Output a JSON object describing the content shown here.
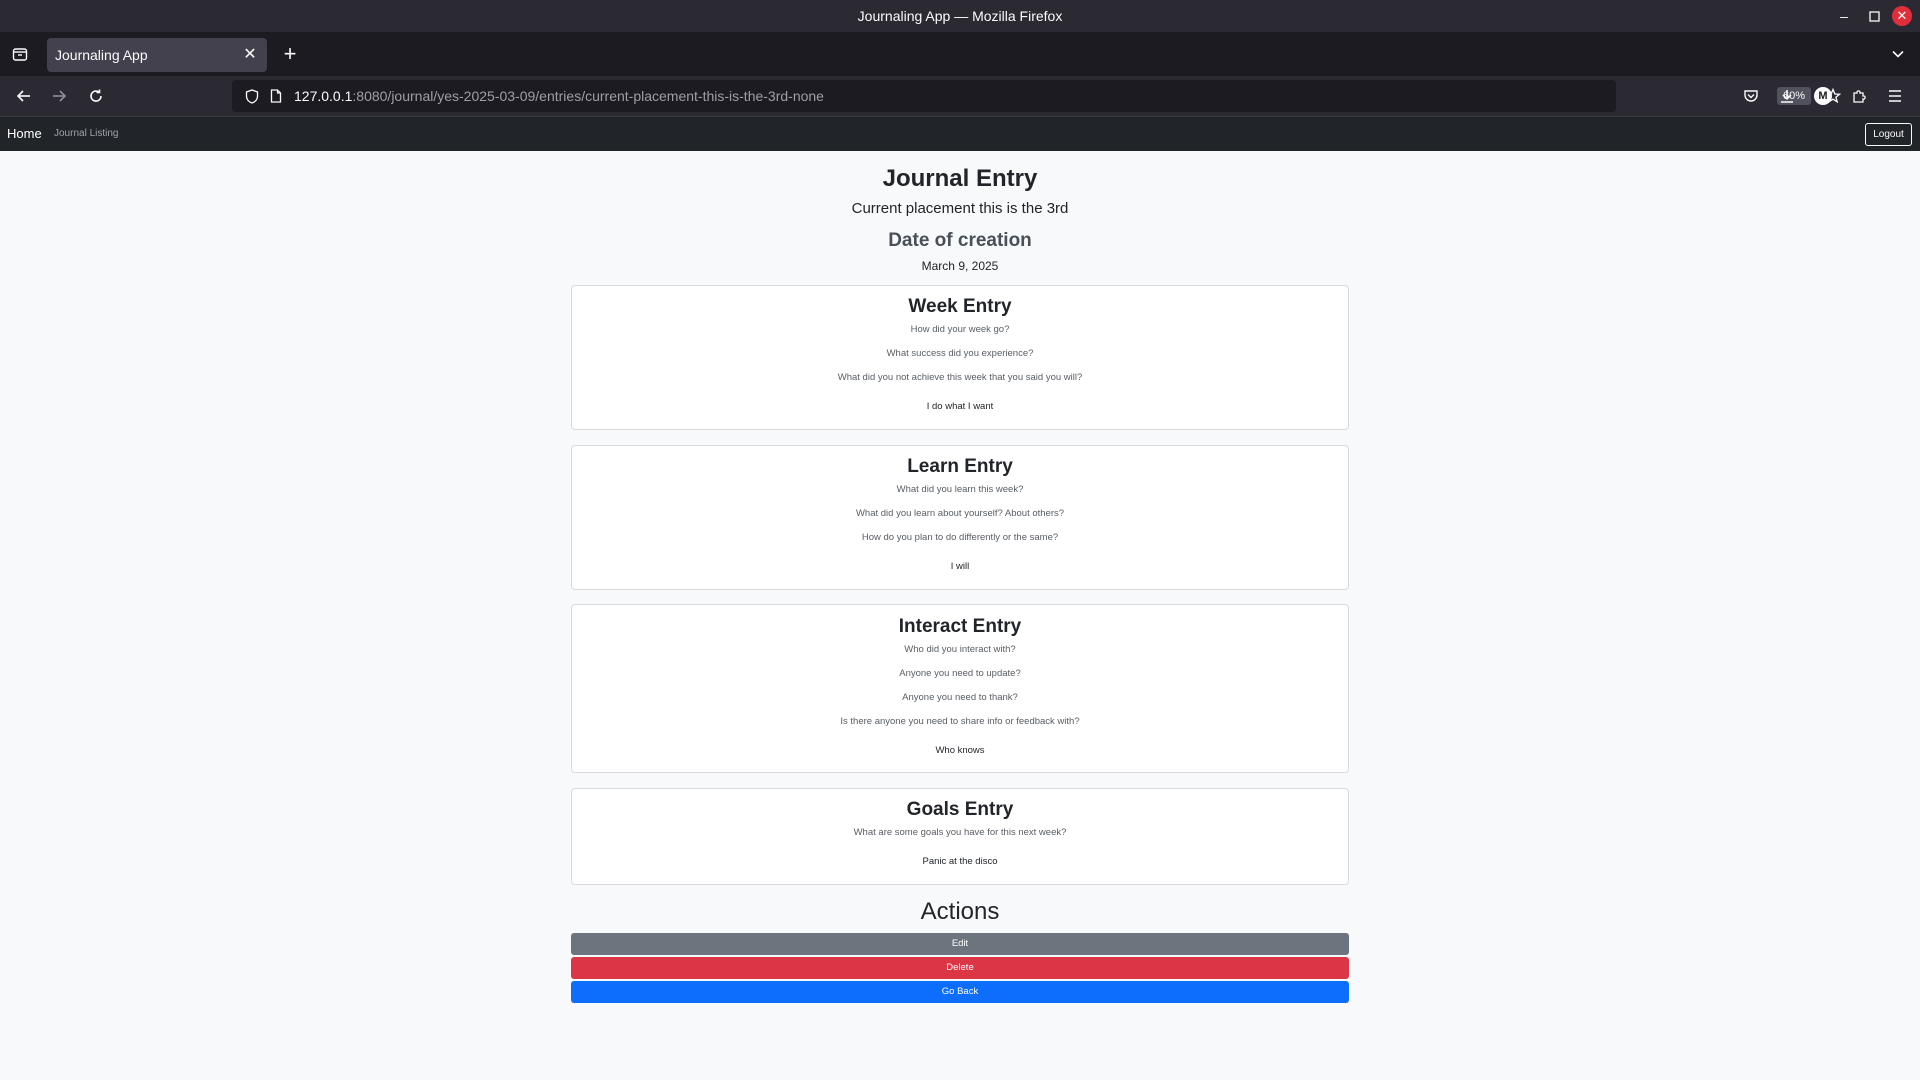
{
  "window": {
    "title": "Journaling App — Mozilla Firefox"
  },
  "browser": {
    "tab_title": "Journaling App",
    "url_host": "127.0.0.1",
    "url_rest": ":8080/journal/yes-2025-03-09/entries/current-placement-this-is-the-3rd-none",
    "zoom": "60%",
    "account_initial": "M"
  },
  "app_nav": {
    "brand": "Home",
    "link": "Journal Listing",
    "logout": "Logout"
  },
  "entry": {
    "title": "Journal Entry",
    "subtitle": "Current placement this is the 3rd",
    "date_label": "Date of creation",
    "date_value": "March 9, 2025"
  },
  "sections": {
    "week": {
      "title": "Week Entry",
      "prompts": [
        "How did your week go?",
        "What success did you experience?",
        "What did you not achieve this week that you said you will?"
      ],
      "answer": "I do what I want"
    },
    "learn": {
      "title": "Learn Entry",
      "prompts": [
        "What did you learn this week?",
        "What did you learn about yourself? About others?",
        "How do you plan to do differently or the same?"
      ],
      "answer": "I will"
    },
    "interact": {
      "title": "Interact Entry",
      "prompts": [
        "Who did you interact with?",
        "Anyone you need to update?",
        "Anyone you need to thank?",
        "Is there anyone you need to share info or feedback with?"
      ],
      "answer": "Who knows"
    },
    "goals": {
      "title": "Goals Entry",
      "prompts": [
        "What are some goals you have for this next week?"
      ],
      "answer": "Panic at the disco"
    }
  },
  "actions": {
    "title": "Actions",
    "edit": "Edit",
    "delete": "Delete",
    "back": "Go Back"
  },
  "colors": {
    "edit": "#6c757d",
    "delete": "#dc3545",
    "back": "#0d6efd",
    "close_button": "#e22e3b"
  }
}
